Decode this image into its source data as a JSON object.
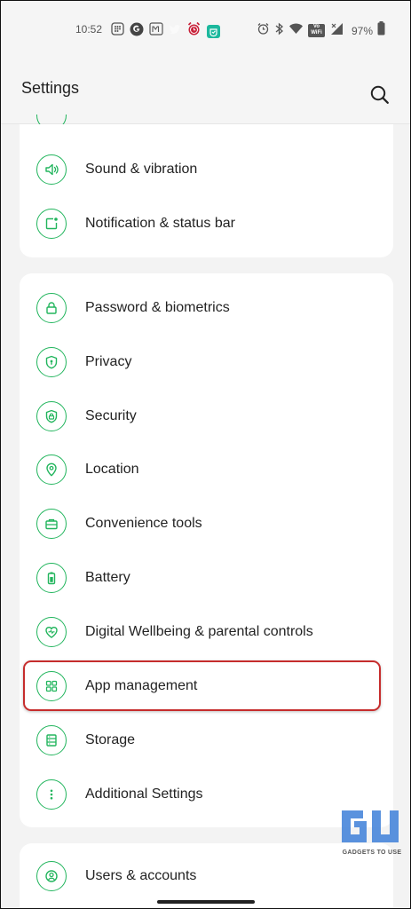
{
  "status_bar": {
    "time": "10:52",
    "battery": "97%",
    "left_icons": [
      "grid-icon",
      "google-icon",
      "m-icon",
      "twitter-icon",
      "alarm-app-icon",
      "mi-icon"
    ],
    "right_icons": [
      "alarm-icon",
      "bluetooth-icon",
      "wifi-icon",
      "vowifi-icon",
      "signal-icon",
      "battery-icon"
    ],
    "vowifi": "Vo WiFi"
  },
  "header": {
    "title": "Settings"
  },
  "accent_color": "#22b55d",
  "cards": [
    {
      "items": [
        {
          "label": "Sound & vibration",
          "icon": "speaker-icon"
        },
        {
          "label": "Notification & status bar",
          "icon": "notification-icon"
        }
      ]
    },
    {
      "items": [
        {
          "label": "Password & biometrics",
          "icon": "lock-icon"
        },
        {
          "label": "Privacy",
          "icon": "privacy-shield-icon"
        },
        {
          "label": "Security",
          "icon": "security-shield-icon"
        },
        {
          "label": "Location",
          "icon": "location-pin-icon"
        },
        {
          "label": "Convenience tools",
          "icon": "toolbox-icon"
        },
        {
          "label": "Battery",
          "icon": "battery-icon"
        },
        {
          "label": "Digital Wellbeing & parental controls",
          "icon": "heart-icon"
        },
        {
          "label": "App management",
          "icon": "apps-grid-icon",
          "highlighted": true
        },
        {
          "label": "Storage",
          "icon": "storage-icon"
        },
        {
          "label": "Additional Settings",
          "icon": "more-dots-icon"
        }
      ]
    },
    {
      "items": [
        {
          "label": "Users & accounts",
          "icon": "user-icon"
        }
      ]
    }
  ],
  "watermark": {
    "text": "GADGETS TO USE"
  }
}
